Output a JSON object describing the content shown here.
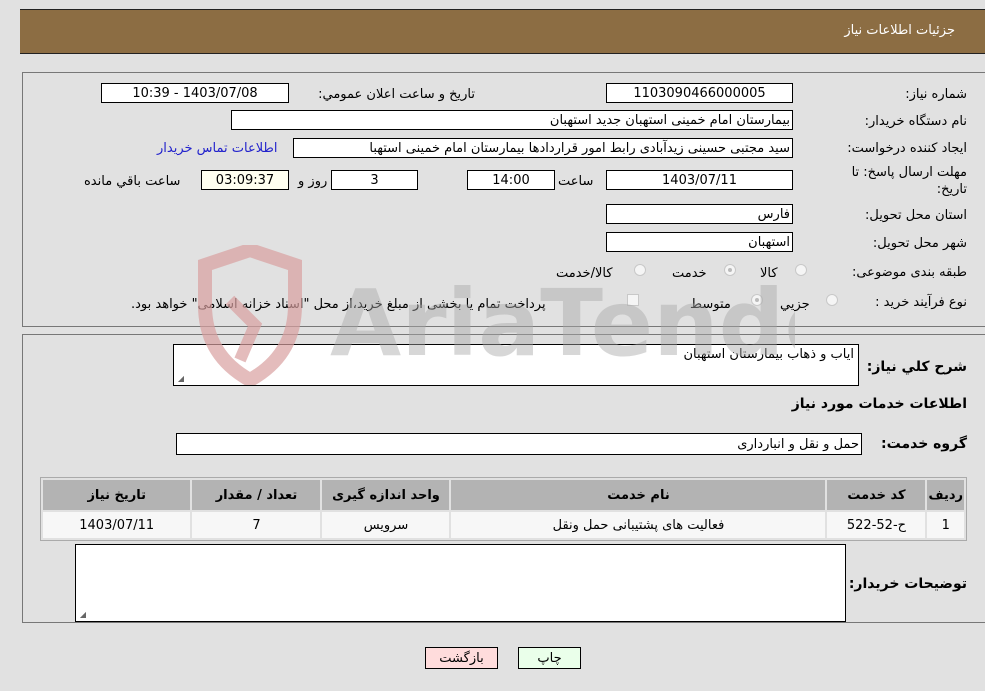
{
  "header": {
    "title": "جزئیات اطلاعات نیاز"
  },
  "details": {
    "need_number_label": "شماره نیاز:",
    "need_number": "1103090466000005",
    "announce_label": "تاریخ و ساعت اعلان عمومي:",
    "announce_value": "1403/07/08 - 10:39",
    "buyer_org_label": "نام دستگاه خریدار:",
    "buyer_org": "بیمارستان امام خمینی استهبان جدید استهبان",
    "creator_label": "ایجاد کننده درخواست:",
    "creator": "سید مجتبی حسینی زیدآبادی رابط امور قراردادها بیمارستان امام خمینی استهبا",
    "contact_link": "اطلاعات تماس خریدار",
    "deadline_label_1": "مهلت ارسال پاسخ: تا",
    "deadline_label_2": "تاریخ:",
    "deadline_date": "1403/07/11",
    "time_label": "ساعت",
    "deadline_time": "14:00",
    "days_value": "3",
    "days_label": "روز و",
    "remaining_time": "03:09:37",
    "remaining_label": "ساعت باقي مانده",
    "province_label": "استان محل تحویل:",
    "province": "فارس",
    "city_label": "شهر محل تحویل:",
    "city": "استهبان",
    "category_label": "طبقه بندی موضوعی:",
    "category_options": [
      {
        "label": "کالا",
        "selected": false
      },
      {
        "label": "خدمت",
        "selected": true
      },
      {
        "label": "کالا/خدمت",
        "selected": false
      }
    ],
    "process_label": "نوع فرآیند خرید :",
    "process_options": [
      {
        "label": "جزيي",
        "selected": false
      },
      {
        "label": "متوسط",
        "selected": true
      }
    ],
    "treasury_note": "پرداخت تمام یا بخشی از مبلغ خرید،از محل \"اسناد خزانه اسلامی\" خواهد بود."
  },
  "summary": {
    "description_label": "شرح کلي نیاز:",
    "description": "ایاب و ذهاب بیمارستان استهبان",
    "services_heading": "اطلاعات خدمات مورد نیاز",
    "service_group_label": "گروه خدمت:",
    "service_group": "حمل و نقل و انبارداری",
    "table": {
      "headers": [
        "ردیف",
        "کد خدمت",
        "نام خدمت",
        "واحد اندازه گیری",
        "تعداد / مقدار",
        "تاریخ نیاز"
      ],
      "rows": [
        [
          "1",
          "ح-52-522",
          "فعالیت های پشتیبانی حمل ونقل",
          "سرویس",
          "7",
          "1403/07/11"
        ]
      ]
    },
    "buyer_notes_label": "توضیحات خریدار:",
    "buyer_notes": ""
  },
  "buttons": {
    "print": "چاپ",
    "back": "بازگشت"
  },
  "watermark": {
    "text": "AriaTender.neT"
  },
  "colors": {
    "header": "#8c6d43",
    "print_btn": "#eaffea",
    "back_btn": "#ffdcdc",
    "link": "#2222cc"
  }
}
